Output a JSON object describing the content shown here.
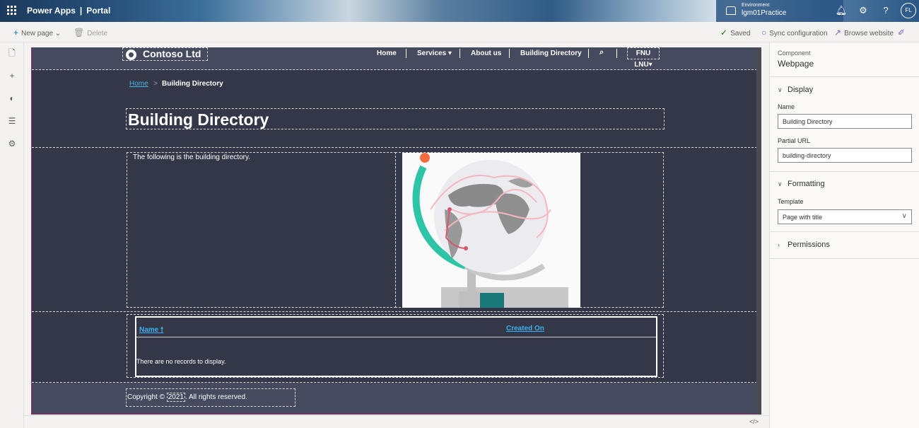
{
  "header": {
    "app_name": "Power Apps",
    "separator": "|",
    "section": "Portal",
    "environment_label": "Environment",
    "environment_name": "lgm01Practice",
    "user_initials": "FL"
  },
  "command_bar": {
    "new_page": "New page",
    "delete": "Delete",
    "saved": "Saved",
    "sync": "Sync configuration",
    "browse": "Browse website"
  },
  "site": {
    "logo_text": "Contoso Ltd",
    "nav": {
      "home": "Home",
      "services": "Services",
      "about": "About us",
      "directory": "Building Directory",
      "user": "FNU LNU"
    },
    "breadcrumb": {
      "home": "Home",
      "separator": ">",
      "current": "Building Directory"
    },
    "page_title": "Building Directory",
    "intro_text": "The following is the building directory.",
    "grid": {
      "col_name": "Name",
      "col_created": "Created On",
      "empty_message": "There are no records to display."
    },
    "footer": {
      "prefix": "Copyright ©",
      "year": "2021",
      "suffix": ". All rights reserved."
    }
  },
  "panel": {
    "component_label": "Component",
    "component_value": "Webpage",
    "display_section": "Display",
    "name_label": "Name",
    "name_value": "Building Directory",
    "url_label": "Partial URL",
    "url_value": "building-directory",
    "formatting_section": "Formatting",
    "template_label": "Template",
    "template_value": "Page with title",
    "permissions_section": "Permissions"
  },
  "colors": {
    "canvas_bg": "#333747",
    "site_header_bg": "#454a5e",
    "link": "#3bb0f0",
    "accent": "#0078d4"
  }
}
